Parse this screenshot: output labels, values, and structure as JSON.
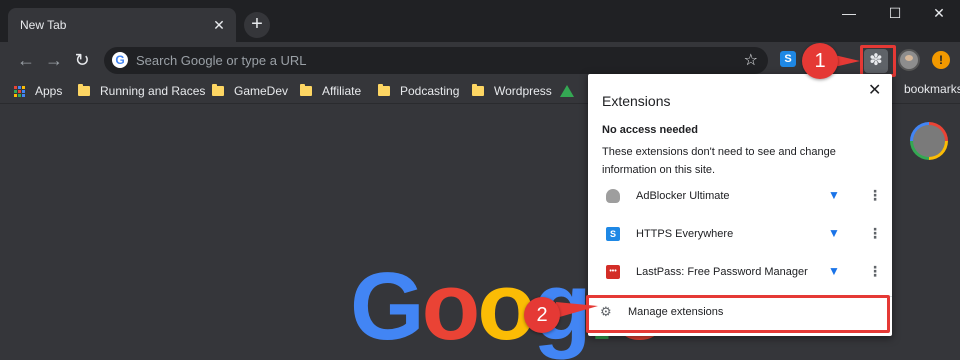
{
  "tab": {
    "title": "New Tab"
  },
  "window_controls": {
    "minimize": "—",
    "maximize": "☐",
    "close": "✕"
  },
  "toolbar": {
    "back_glyph": "←",
    "forward_glyph": "→",
    "reload_glyph": "↻",
    "omnibox_placeholder": "Search Google or type a URL",
    "google_glyph": "G",
    "star_glyph": "☆",
    "ext_s_glyph": "S",
    "puzzle_glyph": "✽",
    "update_glyph": "!"
  },
  "bookmarks": [
    {
      "label": "Apps",
      "icon": "apps-grid-icon"
    },
    {
      "label": "Running and Races",
      "icon": "folder-icon"
    },
    {
      "label": "GameDev",
      "icon": "folder-icon"
    },
    {
      "label": "Affiliate",
      "icon": "folder-icon"
    },
    {
      "label": "Podcasting",
      "icon": "folder-icon"
    },
    {
      "label": "Wordpress",
      "icon": "folder-icon"
    }
  ],
  "bookmarks_tail": "bookmarks",
  "logo": {
    "letters": [
      "G",
      "o",
      "o",
      "g",
      "l",
      "e"
    ],
    "colors": [
      "#4285f4",
      "#ea4335",
      "#fbbc05",
      "#4285f4",
      "#34a853",
      "#ea4335"
    ]
  },
  "popup": {
    "title": "Extensions",
    "close_glyph": "✕",
    "section_heading": "No access needed",
    "section_desc": "These extensions don't need to see and change information on this site.",
    "extensions": [
      {
        "name": "AdBlocker Ultimate",
        "icon": "shield-icon",
        "color": "#9e9e9e",
        "glyph": "⛉"
      },
      {
        "name": "HTTPS Everywhere",
        "icon": "https-s-icon",
        "color": "#1e88e5",
        "glyph": "S"
      },
      {
        "name": "LastPass: Free Password Manager",
        "icon": "lastpass-icon",
        "color": "#d32d27",
        "glyph": "•••"
      }
    ],
    "pin_glyph": "📌",
    "more_glyph": "⋮",
    "manage_label": "Manage extensions",
    "gear_glyph": "⚙"
  },
  "callouts": [
    {
      "label": "1"
    },
    {
      "label": "2"
    }
  ],
  "colors": {
    "accent_red": "#e53935",
    "pin_blue": "#1a73e8",
    "folder_yellow": "#fdd663"
  }
}
